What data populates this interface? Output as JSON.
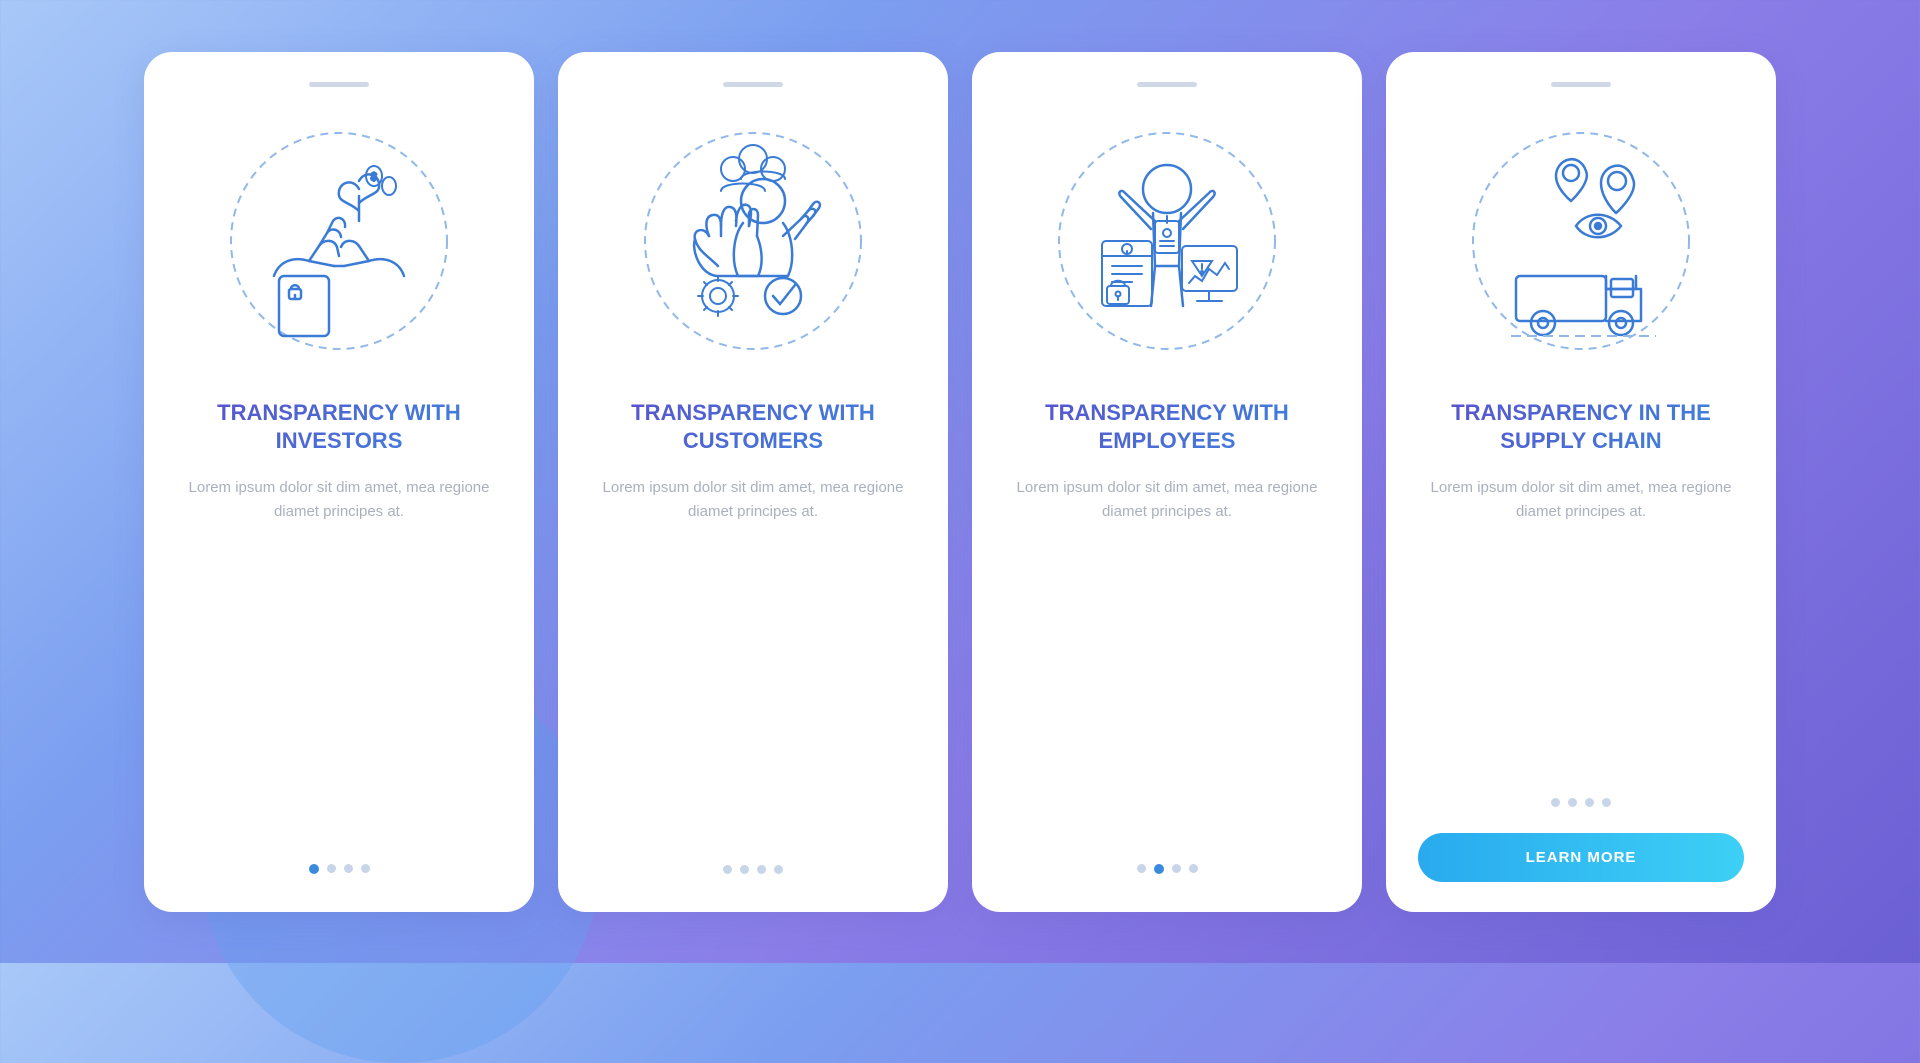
{
  "background": {
    "gradient_start": "#a8c8f8",
    "gradient_end": "#6b5fd4"
  },
  "cards": [
    {
      "id": "investors",
      "title": "TRANSPARENCY WITH INVESTORS",
      "body": "Lorem ipsum dolor sit dim amet, mea regione diamet principes at.",
      "dots": [
        1,
        0,
        0,
        0
      ],
      "active_dot": 0,
      "has_button": false
    },
    {
      "id": "customers",
      "title": "TRANSPARENCY WITH CUSTOMERS",
      "body": "Lorem ipsum dolor sit dim amet, mea regione diamet principes at.",
      "dots": [
        0,
        0,
        0,
        0
      ],
      "active_dot": -1,
      "has_button": false
    },
    {
      "id": "employees",
      "title": "TRANSPARENCY WITH EMPLOYEES",
      "body": "Lorem ipsum dolor sit dim amet, mea regione diamet principes at.",
      "dots": [
        0,
        1,
        0,
        0
      ],
      "active_dot": 1,
      "has_button": false
    },
    {
      "id": "supply-chain",
      "title": "TRANSPARENCY IN THE SUPPLY CHAIN",
      "body": "Lorem ipsum dolor sit dim amet, mea regione diamet principes at.",
      "dots": [
        0,
        0,
        0,
        0
      ],
      "active_dot": -1,
      "has_button": true,
      "button_label": "LEARN MORE"
    }
  ]
}
